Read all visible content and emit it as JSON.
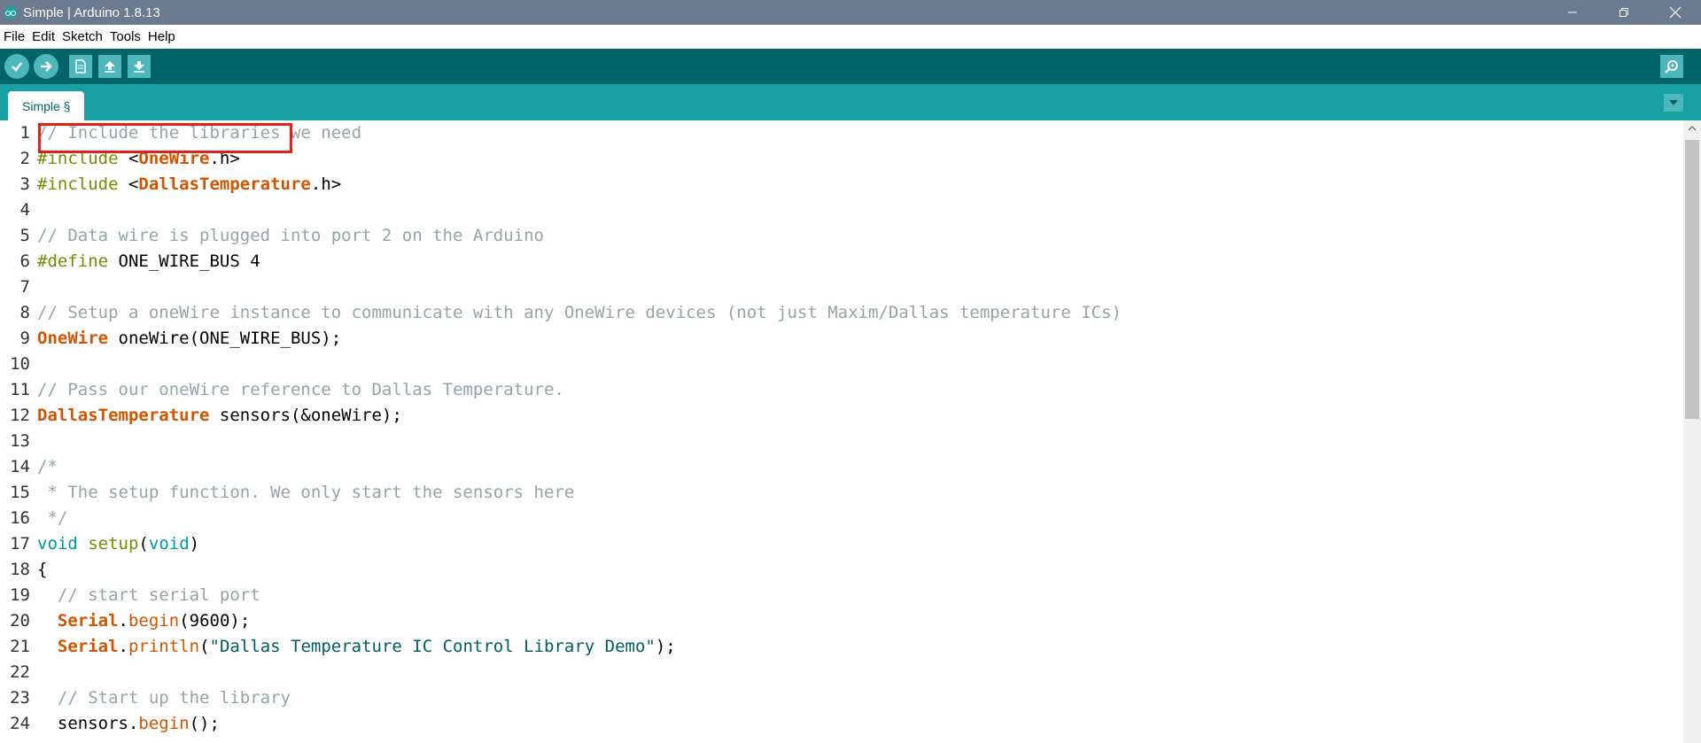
{
  "window": {
    "title": "Simple | Arduino 1.8.13",
    "controls": [
      "minimize-icon",
      "restore-icon",
      "close-icon"
    ]
  },
  "menu": [
    "File",
    "Edit",
    "Sketch",
    "Tools",
    "Help"
  ],
  "toolbar": {
    "buttons": [
      "verify-icon",
      "upload-icon",
      "new-icon",
      "open-icon",
      "save-icon"
    ],
    "right_button": "serial-monitor-icon"
  },
  "tabs": [
    {
      "label": "Simple §"
    }
  ],
  "editor": {
    "lines": [
      [
        {
          "t": "// Include the libraries we need",
          "c": "cm"
        }
      ],
      [
        {
          "t": "#include",
          "c": "kw"
        },
        {
          "t": " <",
          "c": ""
        },
        {
          "t": "OneWire",
          "c": "cls"
        },
        {
          "t": ".h>",
          "c": ""
        }
      ],
      [
        {
          "t": "#include",
          "c": "kw"
        },
        {
          "t": " <",
          "c": ""
        },
        {
          "t": "DallasTemperature",
          "c": "cls"
        },
        {
          "t": ".h>",
          "c": ""
        }
      ],
      [],
      [
        {
          "t": "// Data wire is plugged into port 2 on the Arduino",
          "c": "cm"
        }
      ],
      [
        {
          "t": "#define",
          "c": "kw"
        },
        {
          "t": " ONE_WIRE_BUS 4",
          "c": ""
        }
      ],
      [],
      [
        {
          "t": "// Setup a oneWire instance to communicate with any OneWire devices (not just Maxim/Dallas temperature ICs)",
          "c": "cm"
        }
      ],
      [
        {
          "t": "OneWire",
          "c": "cls"
        },
        {
          "t": " oneWire(ONE_WIRE_BUS);",
          "c": ""
        }
      ],
      [],
      [
        {
          "t": "// Pass our oneWire reference to Dallas Temperature.",
          "c": "cm"
        }
      ],
      [
        {
          "t": "DallasTemperature",
          "c": "cls"
        },
        {
          "t": " sensors(&oneWire);",
          "c": ""
        }
      ],
      [],
      [
        {
          "t": "/*",
          "c": "cm"
        }
      ],
      [
        {
          "t": " * The setup function. We only start the sensors here",
          "c": "cm"
        }
      ],
      [
        {
          "t": " */",
          "c": "cm"
        }
      ],
      [
        {
          "t": "void",
          "c": "ty"
        },
        {
          "t": " ",
          "c": ""
        },
        {
          "t": "setup",
          "c": "kw"
        },
        {
          "t": "(",
          "c": ""
        },
        {
          "t": "void",
          "c": "ty"
        },
        {
          "t": ")",
          "c": ""
        }
      ],
      [
        {
          "t": "{",
          "c": ""
        }
      ],
      [
        {
          "t": "  // start serial port",
          "c": "cm"
        }
      ],
      [
        {
          "t": "  ",
          "c": ""
        },
        {
          "t": "Serial",
          "c": "cls"
        },
        {
          "t": ".",
          "c": ""
        },
        {
          "t": "begin",
          "c": "fn"
        },
        {
          "t": "(9600);",
          "c": ""
        }
      ],
      [
        {
          "t": "  ",
          "c": ""
        },
        {
          "t": "Serial",
          "c": "cls"
        },
        {
          "t": ".",
          "c": ""
        },
        {
          "t": "println",
          "c": "fn"
        },
        {
          "t": "(",
          "c": ""
        },
        {
          "t": "\"Dallas Temperature IC Control Library Demo\"",
          "c": "str"
        },
        {
          "t": ");",
          "c": ""
        }
      ],
      [],
      [
        {
          "t": "  // Start up the library",
          "c": "cm"
        }
      ],
      [
        {
          "t": "  sensors.",
          "c": ""
        },
        {
          "t": "begin",
          "c": "fn"
        },
        {
          "t": "();",
          "c": ""
        }
      ]
    ],
    "highlighted_line": 6
  },
  "colors": {
    "titlebar": "#6b7a8f",
    "toolbar": "#006468",
    "tabbar": "#17a1a5",
    "highlight_box": "#e0201c"
  }
}
